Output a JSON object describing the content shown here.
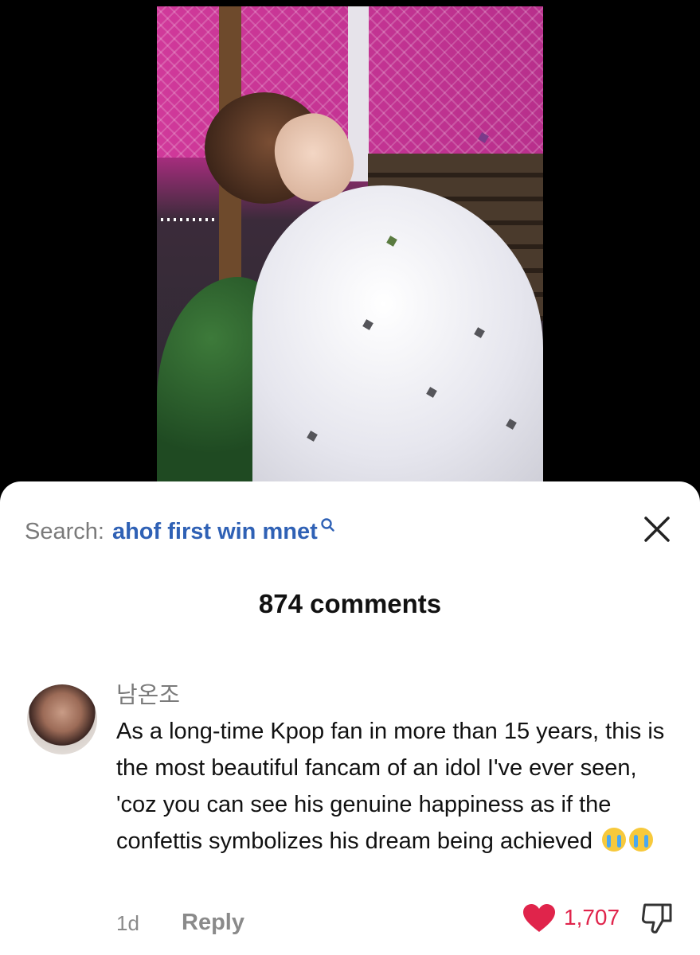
{
  "search": {
    "prefix": "Search:",
    "query": "ahof first win mnet"
  },
  "comments": {
    "count_label": "874 comments"
  },
  "comment": {
    "username": "남온조",
    "text": "As a long-time Kpop fan in more than 15 years, this is the most beautiful fancam of an idol I've ever seen, 'coz you can see his genuine happiness as if the confettis symbolizes his dream being achieved",
    "emoji": [
      "loudly-crying-face",
      "loudly-crying-face"
    ],
    "time": "1d",
    "reply_label": "Reply",
    "likes": "1,707",
    "liked": true
  },
  "colors": {
    "search_query": "#2f61b5",
    "like": "#e0244b",
    "muted": "#8a8a8a"
  },
  "icons": {
    "search": "search-icon",
    "close": "close-icon",
    "like": "heart-icon",
    "dislike": "thumbs-down-icon"
  }
}
